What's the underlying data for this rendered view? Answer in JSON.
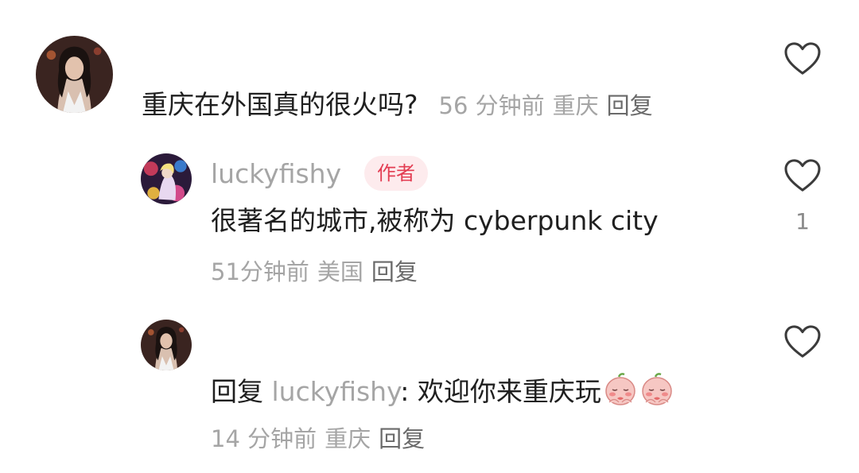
{
  "comments": [
    {
      "text": "重庆在外国真的很火吗?",
      "time": "56 分钟前",
      "location": "重庆",
      "reply_label": "回复"
    }
  ],
  "replies": [
    {
      "username": "luckyfishy",
      "badge": "作者",
      "text": "很著名的城市,被称为 cyberpunk city",
      "like_count": "1",
      "time": "51分钟前",
      "location": "美国",
      "reply_label": "回复"
    },
    {
      "reply_prefix": "回复",
      "reply_to": "luckyfishy",
      "text": ": 欢迎你来重庆玩",
      "time": "14 分钟前",
      "location": "重庆",
      "reply_label": "回复"
    }
  ],
  "icons": {
    "like": "heart-outline-icon",
    "emoji": "blushing-peach-emoji-icon"
  },
  "colors": {
    "text_primary": "#1f1f1f",
    "text_secondary": "#a5a5a5",
    "reply_link": "#6a6a6a",
    "badge_bg": "#fdebed",
    "badge_text": "#e33d52"
  }
}
